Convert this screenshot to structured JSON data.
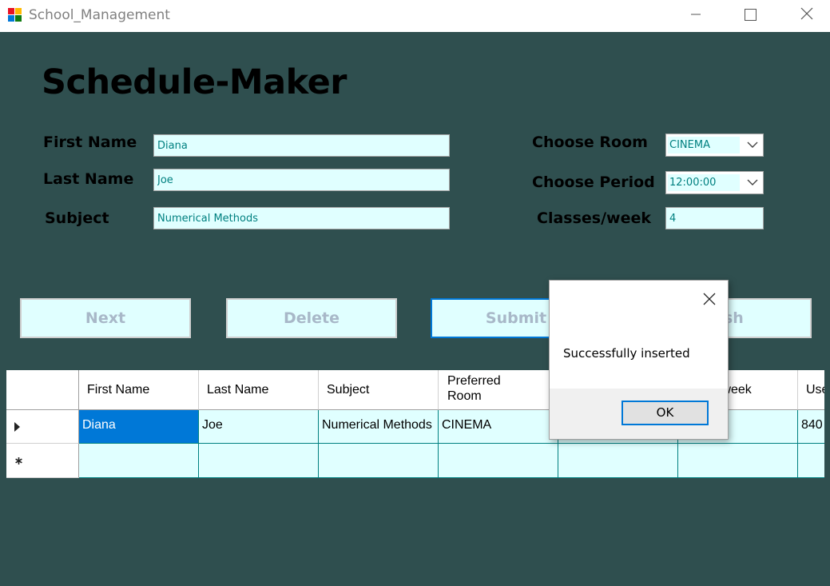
{
  "window": {
    "title": "School_Management",
    "icons": [
      "app-icon",
      "minimize-icon",
      "maximize-icon",
      "close-icon"
    ]
  },
  "form": {
    "heading": "Schedule-Maker",
    "first_name_label": "First Name",
    "first_name_value": "Diana",
    "last_name_label": "Last Name",
    "last_name_value": "Joe",
    "subject_label": "Subject",
    "subject_value": "Numerical Methods",
    "room_label": "Choose Room",
    "room_value": "CINEMA",
    "period_label": "Choose Period",
    "period_value": "12:00:00",
    "classes_label": "Classes/week",
    "classes_value": "4"
  },
  "buttons": {
    "next": "Next",
    "delete": "Delete",
    "submit": "Submit",
    "finish_partial": "sh"
  },
  "grid": {
    "headers": [
      "First Name",
      "Last Name",
      "Subject",
      "Preferred Room",
      "",
      "Classes/week",
      "User"
    ],
    "headers_visible": [
      "First Name",
      "Last Name",
      "Subject",
      "Preferred",
      "Room",
      "/week",
      "Use"
    ],
    "row1": [
      "Diana",
      "Joe",
      "Numerical Methods",
      "CINEMA",
      "",
      "",
      "840"
    ],
    "row_markers": [
      "current-row-arrow-icon",
      "new-row-asterisk-icon"
    ]
  },
  "dialog": {
    "message": "Successfully inserted",
    "ok": "OK"
  },
  "colors": {
    "client_bg": "#2f4f4f",
    "field_bg": "#e0ffff",
    "field_text": "#008080",
    "selection": "#0078d7",
    "button_text": "#a8b8c8"
  }
}
